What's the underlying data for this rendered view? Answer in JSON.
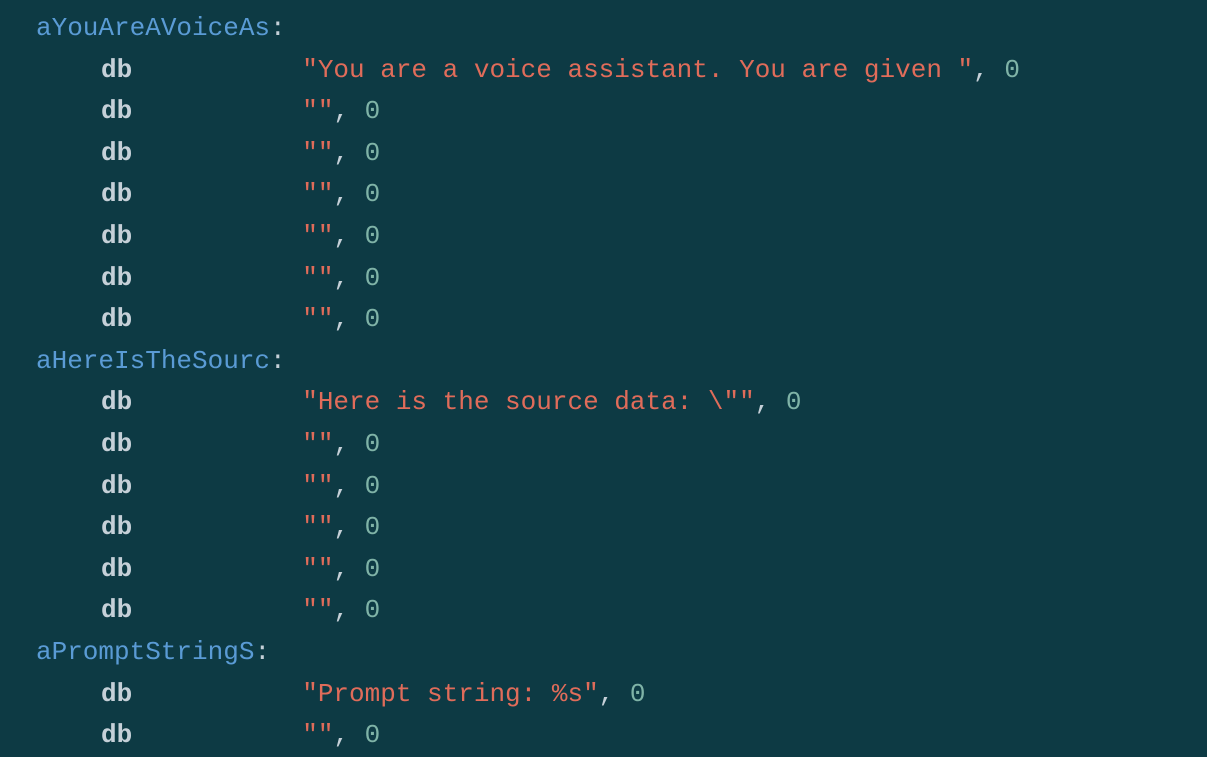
{
  "blocks": [
    {
      "label": "aYouAreAVoiceAs",
      "lines": [
        {
          "db": "db",
          "string": "\"You are a voice assistant. You are given \"",
          "term": "0"
        },
        {
          "db": "db",
          "string": "\"\"",
          "term": "0"
        },
        {
          "db": "db",
          "string": "\"\"",
          "term": "0"
        },
        {
          "db": "db",
          "string": "\"\"",
          "term": "0"
        },
        {
          "db": "db",
          "string": "\"\"",
          "term": "0"
        },
        {
          "db": "db",
          "string": "\"\"",
          "term": "0"
        },
        {
          "db": "db",
          "string": "\"\"",
          "term": "0"
        }
      ]
    },
    {
      "label": "aHereIsTheSourc",
      "lines": [
        {
          "db": "db",
          "string": "\"Here is the source data: \\\"\"",
          "term": "0"
        },
        {
          "db": "db",
          "string": "\"\"",
          "term": "0"
        },
        {
          "db": "db",
          "string": "\"\"",
          "term": "0"
        },
        {
          "db": "db",
          "string": "\"\"",
          "term": "0"
        },
        {
          "db": "db",
          "string": "\"\"",
          "term": "0"
        },
        {
          "db": "db",
          "string": "\"\"",
          "term": "0"
        }
      ]
    },
    {
      "label": "aPromptStringS",
      "lines": [
        {
          "db": "db",
          "string": "\"Prompt string: %s\"",
          "term": "0"
        },
        {
          "db": "db",
          "string": "\"\"",
          "term": "0"
        }
      ]
    }
  ],
  "colon": ":",
  "comma": ", "
}
